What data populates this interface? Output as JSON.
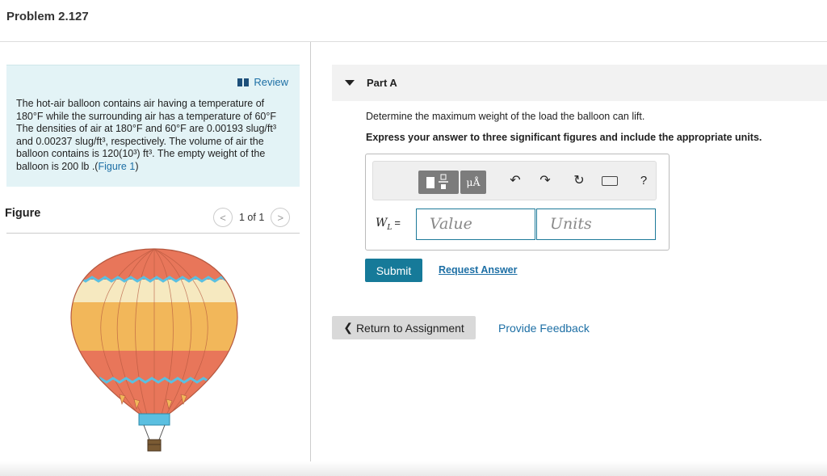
{
  "header": {
    "title": "Problem 2.127"
  },
  "problem": {
    "review_label": "Review",
    "text_before_figure": "The hot-air balloon contains air having a temperature of 180°F while the surrounding air has a temperature of 60°F The densities of air at 180°F and 60°F are 0.00193 slug/ft³ and 0.00237 slug/ft³, respectively. The volume of air the balloon contains is 120(10³) ft³. The empty weight of the balloon is 200 lb .(",
    "figure_link": "Figure 1",
    "text_after_figure": ")"
  },
  "figure": {
    "label": "Figure",
    "prev_label": "<",
    "next_label": ">",
    "counter": "1 of 1",
    "colors": {
      "red": "#e8765a",
      "cream": "#f6e9c0",
      "gold": "#f2b75a",
      "blue": "#5bbfe0",
      "basket": "#7a5a33"
    }
  },
  "part": {
    "title": "Part A",
    "question": "Determine the maximum weight of the load the balloon can lift.",
    "instruction": "Express your answer to three significant figures and include the appropriate units."
  },
  "toolbar": {
    "mu_label": "μÅ",
    "undo_icon": "undo-icon",
    "redo_icon": "redo-icon",
    "reset_icon": "reset-icon",
    "keyboard_icon": "keyboard-icon",
    "help_label": "?"
  },
  "answer": {
    "variable": "W",
    "subscript": "L",
    "equals": "=",
    "value_placeholder": "Value",
    "units_placeholder": "Units"
  },
  "actions": {
    "submit_label": "Submit",
    "request_answer_label": "Request Answer",
    "return_label": "Return to Assignment",
    "feedback_label": "Provide Feedback"
  }
}
